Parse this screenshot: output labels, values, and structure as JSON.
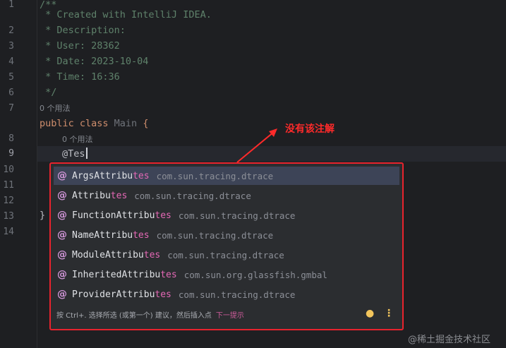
{
  "editor": {
    "line_numbers": [
      "1",
      "2",
      "3",
      "4",
      "5",
      "6",
      "7",
      "8",
      "9",
      "10",
      "11",
      "12",
      "13",
      "14"
    ],
    "lines": {
      "l1": "/**",
      "l2": " * Created with IntelliJ IDEA.",
      "l3": " * Description:",
      "l4": " * User: 28362",
      "l5": " * Date: 2023-10-04",
      "l6": " * Time: 16:36",
      "l7": " */",
      "l8_kw": "public class ",
      "l8_name": "Main",
      "l8_brace": " {",
      "l9": "@Tes",
      "l13": "}"
    },
    "usage_hint_class": "0 个用法",
    "usage_hint_member": "0 个用法"
  },
  "completion": {
    "items": [
      {
        "prefix": "ArgsAttribu",
        "match": "tes",
        "package": "com.sun.tracing.dtrace"
      },
      {
        "prefix": "Attribu",
        "match": "tes",
        "package": "com.sun.tracing.dtrace"
      },
      {
        "prefix": "FunctionAttribu",
        "match": "tes",
        "package": "com.sun.tracing.dtrace"
      },
      {
        "prefix": "NameAttribu",
        "match": "tes",
        "package": "com.sun.tracing.dtrace"
      },
      {
        "prefix": "ModuleAttribu",
        "match": "tes",
        "package": "com.sun.tracing.dtrace"
      },
      {
        "prefix": "InheritedAttribu",
        "match": "tes",
        "package": "com.sun.org.glassfish.gmbal"
      },
      {
        "prefix": "ProviderAttribu",
        "match": "tes",
        "package": "com.sun.tracing.dtrace"
      }
    ],
    "footer_text": "按 Ctrl+. 选择所选 (或第一个) 建议，然后插入点",
    "footer_link": "下一提示",
    "icon_item": "annotation-icon",
    "icon_bulb": "lightbulb-icon",
    "icon_menu": "more-vertical-icon"
  },
  "annotation": {
    "text": "没有该注解",
    "color": "#ff2a2a"
  },
  "watermark": "@稀土掘金技术社区"
}
